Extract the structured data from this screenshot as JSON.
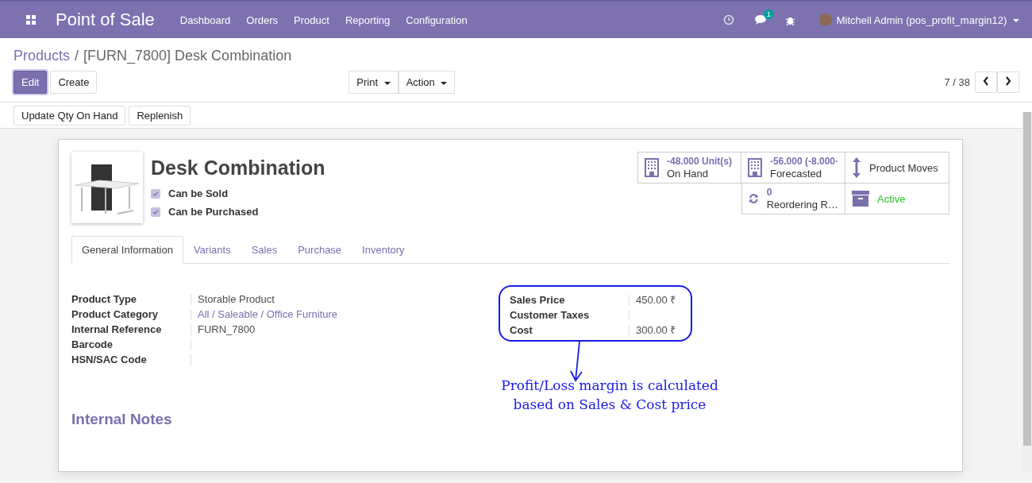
{
  "navbar": {
    "app_title": "Point of Sale",
    "menu": [
      "Dashboard",
      "Orders",
      "Product",
      "Reporting",
      "Configuration"
    ],
    "chat_badge": "1",
    "user": "Mitchell Admin (pos_profit_margin12)"
  },
  "breadcrumb": {
    "parent": "Products",
    "separator": "/",
    "current": "[FURN_7800] Desk Combination"
  },
  "buttons": {
    "main": [
      {
        "label": "Edit",
        "primary": true
      },
      {
        "label": "Create",
        "primary": false
      }
    ],
    "dropdowns": [
      "Print",
      "Action"
    ]
  },
  "pager": "7 / 38",
  "header_buttons": [
    "Update Qty On Hand",
    "Replenish"
  ],
  "product": {
    "name": "Desk Combination",
    "options": [
      {
        "label": "Can be Sold",
        "checked": true
      },
      {
        "label": "Can be Purchased",
        "checked": true
      }
    ]
  },
  "smart_buttons": [
    {
      "kind": "stat",
      "value": "-48.000 Unit(s)",
      "label": "On Hand"
    },
    {
      "kind": "stat",
      "value": "-56.000 (-8.000·",
      "label": "Forecasted"
    },
    {
      "kind": "text",
      "label": "Product Moves"
    },
    {
      "kind": "stat",
      "value": "0",
      "label": "Reordering R…"
    },
    {
      "kind": "toggle",
      "label": "Active",
      "active": true
    }
  ],
  "tabs": [
    {
      "label": "General Information",
      "selected": true
    },
    {
      "label": "Variants",
      "selected": false
    },
    {
      "label": "Sales",
      "selected": false
    },
    {
      "label": "Purchase",
      "selected": false
    },
    {
      "label": "Inventory",
      "selected": false
    }
  ],
  "left_fields": [
    {
      "label": "Product Type",
      "value": "Storable Product",
      "kind": "text"
    },
    {
      "label": "Product Category",
      "value": "All / Saleable / Office Furniture",
      "kind": "link"
    },
    {
      "label": "Internal Reference",
      "value": "FURN_7800",
      "kind": "text"
    },
    {
      "label": "Barcode"
    },
    {
      "label": "HSN/SAC Code"
    }
  ],
  "price_fields": [
    {
      "label": "Sales Price",
      "value": "450.00 ₹"
    },
    {
      "label": "Customer Taxes"
    },
    {
      "label": "Cost",
      "value": "300.00 ₹"
    }
  ],
  "annotation": [
    "Profit/Loss margin is calculated",
    "based on Sales & Cost price"
  ],
  "notes_heading": "Internal Notes"
}
